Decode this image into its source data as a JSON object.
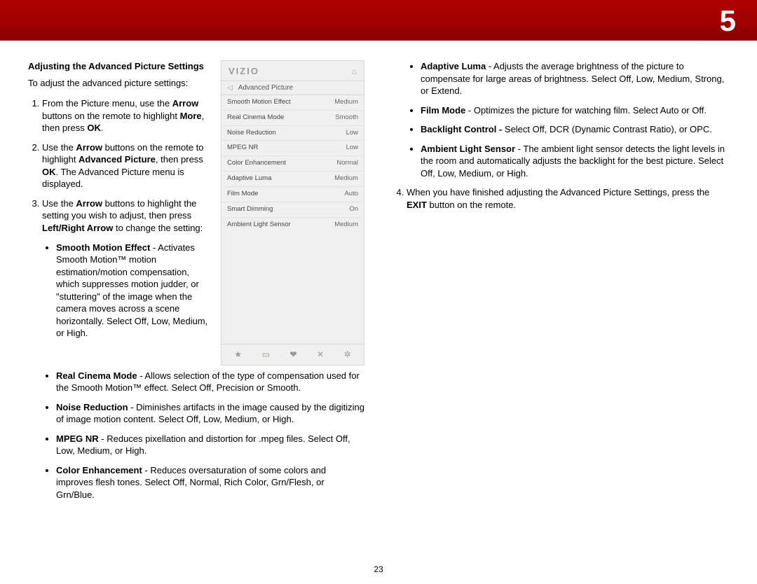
{
  "chapter_number": "5",
  "page_number": "23",
  "col1": {
    "heading": "Adjusting the Advanced Picture Settings",
    "intro": "To adjust the advanced picture settings:",
    "step1": "From the Picture menu, use the <b>Arrow</b> buttons on the remote to highlight <b>More</b>, then press <b>OK</b>.",
    "step2": "Use the <b>Arrow</b> buttons on the remote to highlight <b>Advanced Picture</b>, then press <b>OK</b>. The Advanced Picture menu is displayed.",
    "step3": "Use the <b>Arrow</b> buttons to highlight the setting you wish to adjust, then press <b>Left/Right Arrow</b> to change the setting:",
    "b_smooth": "<b>Smooth Motion Effect</b> - Activates Smooth Motion™ motion estimation/motion compensation, which suppresses motion judder, or \"stuttering\" of the image when the camera moves across a scene horizontally. Select Off, Low, Medium, or High.",
    "b_cinema": "<b>Real Cinema Mode</b> - Allows selection of the type of compensation used for the Smooth Motion™ effect. Select Off, Precision or Smooth.",
    "b_noise": "<b>Noise Reduction</b> - Diminishes artifacts in the image caused by the digitizing of image motion content. Select Off, Low, Medium, or High.",
    "b_mpeg": "<b>MPEG NR</b> - Reduces pixellation and distortion for .mpeg files. Select Off, Low, Medium, or High.",
    "b_color": "<b>Color Enhancement</b> - Reduces oversaturation of some colors and improves flesh tones. Select Off, Normal, Rich Color, Grn/Flesh, or Grn/Blue."
  },
  "col2": {
    "b_luma": "<b>Adaptive Luma</b> - Adjusts the average brightness of the picture to compensate for large areas of brightness. Select Off, Low, Medium, Strong, or Extend.",
    "b_film": "<b>Film Mode</b> - Optimizes the picture for watching film. Select Auto or Off.",
    "b_backlight": "<b>Backlight Control -</b> Select Off, DCR (Dynamic Contrast Ratio), or OPC.",
    "b_ambient": "<b>Ambient Light Sensor</b> - The ambient light sensor detects the light levels in the room and automatically adjusts the backlight for the best picture. Select Off, Low, Medium, or High.",
    "step4": "When you have finished adjusting the Advanced Picture Settings, press the <b>EXIT</b> button on the remote."
  },
  "tv": {
    "logo": "VIZIO",
    "menu_title": "Advanced Picture",
    "rows": [
      {
        "label": "Smooth Motion Effect",
        "value": "Medium"
      },
      {
        "label": "Real Cinema Mode",
        "value": "Smooth"
      },
      {
        "label": "Noise Reduction",
        "value": "Low"
      },
      {
        "label": "MPEG NR",
        "value": "Low"
      },
      {
        "label": "Color Enhancement",
        "value": "Normal"
      },
      {
        "label": "Adaptive Luma",
        "value": "Medium"
      },
      {
        "label": "Film Mode",
        "value": "Auto"
      },
      {
        "label": "Smart Dimming",
        "value": "On"
      },
      {
        "label": "Ambient Light Sensor",
        "value": "Medium"
      }
    ]
  }
}
